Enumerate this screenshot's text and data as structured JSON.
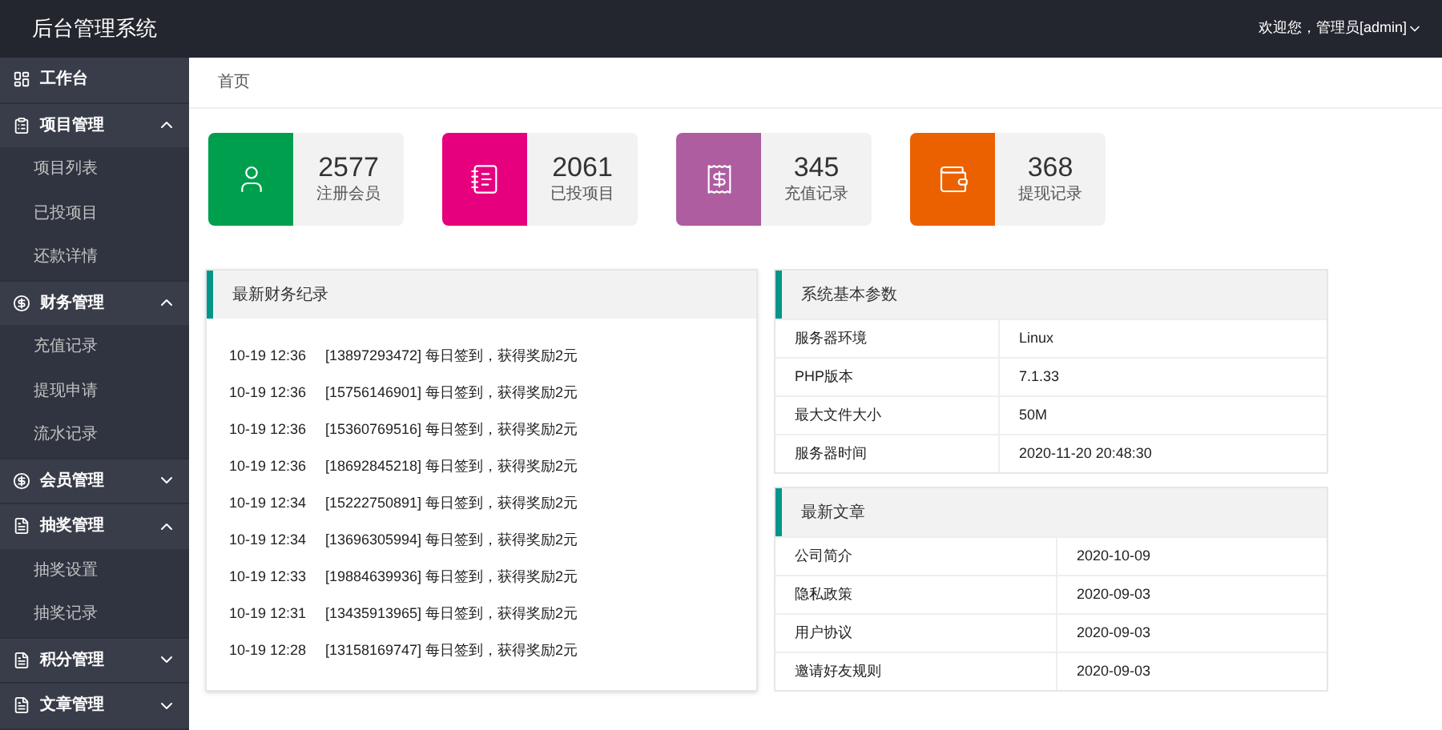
{
  "header": {
    "title": "后台管理系统",
    "user": "欢迎您，管理员[admin]"
  },
  "sidebar": {
    "items": [
      {
        "kind": "link",
        "label": "工作台"
      },
      {
        "kind": "group",
        "label": "项目管理",
        "expanded": true,
        "children": [
          {
            "label": "项目列表"
          },
          {
            "label": "已投项目"
          },
          {
            "label": "还款详情"
          }
        ]
      },
      {
        "kind": "group",
        "label": "财务管理",
        "expanded": true,
        "children": [
          {
            "label": "充值记录"
          },
          {
            "label": "提现申请"
          },
          {
            "label": "流水记录"
          }
        ]
      },
      {
        "kind": "group",
        "label": "会员管理",
        "expanded": false
      },
      {
        "kind": "group",
        "label": "抽奖管理",
        "expanded": true,
        "children": [
          {
            "label": "抽奖设置"
          },
          {
            "label": "抽奖记录"
          }
        ]
      },
      {
        "kind": "group",
        "label": "积分管理",
        "expanded": false
      },
      {
        "kind": "group",
        "label": "文章管理",
        "expanded": false
      }
    ]
  },
  "breadcrumb": "首页",
  "stats": [
    {
      "value": "2577",
      "label": "注册会员",
      "color": "#009f4d"
    },
    {
      "value": "2061",
      "label": "已投项目",
      "color": "#e6007e"
    },
    {
      "value": "345",
      "label": "充值记录",
      "color": "#ae5da1"
    },
    {
      "value": "368",
      "label": "提现记录",
      "color": "#eb6100"
    }
  ],
  "finance": {
    "title": "最新财务纪录",
    "rows": [
      {
        "time": "10-19 12:36",
        "text": "[13897293472] 每日签到，获得奖励2元"
      },
      {
        "time": "10-19 12:36",
        "text": "[15756146901] 每日签到，获得奖励2元"
      },
      {
        "time": "10-19 12:36",
        "text": "[15360769516] 每日签到，获得奖励2元"
      },
      {
        "time": "10-19 12:36",
        "text": "[18692845218] 每日签到，获得奖励2元"
      },
      {
        "time": "10-19 12:34",
        "text": "[15222750891] 每日签到，获得奖励2元"
      },
      {
        "time": "10-19 12:34",
        "text": "[13696305994] 每日签到，获得奖励2元"
      },
      {
        "time": "10-19 12:33",
        "text": "[19884639936] 每日签到，获得奖励2元"
      },
      {
        "time": "10-19 12:31",
        "text": "[13435913965] 每日签到，获得奖励2元"
      },
      {
        "time": "10-19 12:28",
        "text": "[13158169747] 每日签到，获得奖励2元"
      }
    ]
  },
  "system": {
    "title": "系统基本参数",
    "rows": [
      {
        "name": "服务器环境",
        "value": "Linux"
      },
      {
        "name": "PHP版本",
        "value": "7.1.33"
      },
      {
        "name": "最大文件大小",
        "value": "50M"
      },
      {
        "name": "服务器时间",
        "value": "2020-11-20 20:48:30"
      }
    ]
  },
  "articles": {
    "title": "最新文章",
    "rows": [
      {
        "name": "公司简介",
        "date": "2020-10-09"
      },
      {
        "name": "隐私政策",
        "date": "2020-09-03"
      },
      {
        "name": "用户协议",
        "date": "2020-09-03"
      },
      {
        "name": "邀请好友规则",
        "date": "2020-09-03"
      }
    ]
  }
}
